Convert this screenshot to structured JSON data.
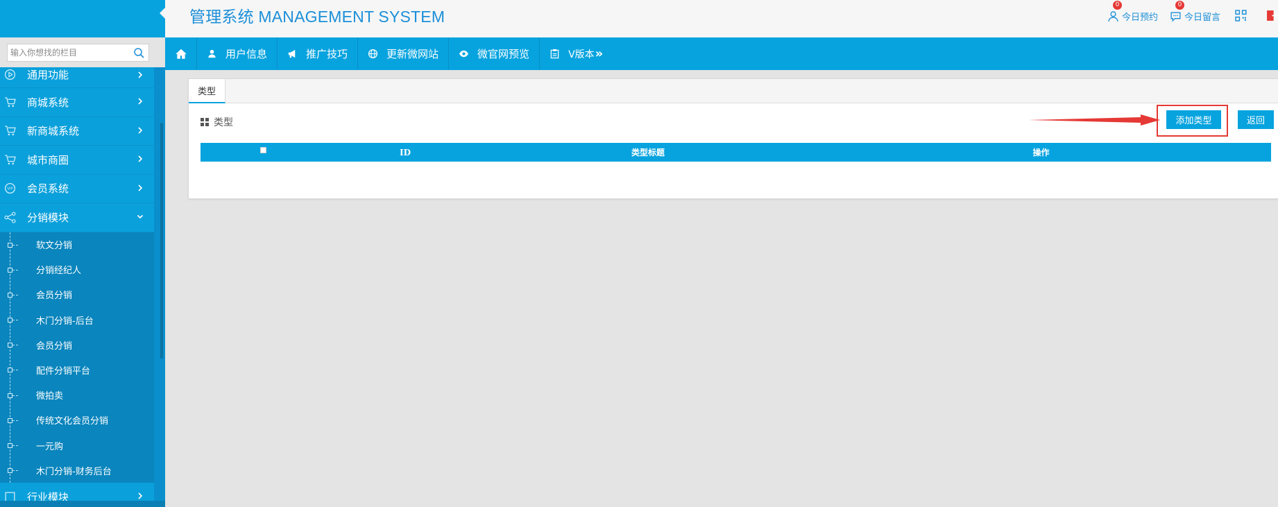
{
  "header": {
    "title": "管理系统 MANAGEMENT SYSTEM",
    "appointments": {
      "label": "今日预约",
      "count": "0"
    },
    "messages": {
      "label": "今日留言",
      "count": "0"
    }
  },
  "search": {
    "placeholder": "输入你想找的栏目"
  },
  "navbar": {
    "items": [
      {
        "label": "用户信息",
        "icon": "user-icon"
      },
      {
        "label": "推广技巧",
        "icon": "megaphone-icon"
      },
      {
        "label": "更新微网站",
        "icon": "globe-icon"
      },
      {
        "label": "微官网预览",
        "icon": "eye-icon"
      },
      {
        "label": "V版本",
        "icon": "clipboard-icon"
      }
    ]
  },
  "sidebar": {
    "items": [
      {
        "label": "通用功能",
        "icon": "play-circle-icon"
      },
      {
        "label": "商城系统",
        "icon": "cart-icon"
      },
      {
        "label": "新商城系统",
        "icon": "cart-icon"
      },
      {
        "label": "城市商圈",
        "icon": "cart-icon"
      },
      {
        "label": "会员系统",
        "icon": "vip-icon"
      },
      {
        "label": "分销模块",
        "icon": "share-icon"
      }
    ],
    "sub_items": [
      "软文分销",
      "分销经纪人",
      "会员分销",
      "木门分销-后台",
      "会员分销",
      "配件分销平台",
      "微拍卖",
      "传统文化会员分销",
      "一元购",
      "木门分销-财务后台"
    ],
    "last_item": "行业模块"
  },
  "panel": {
    "tab": "类型",
    "section_title": "类型",
    "add_button": "添加类型",
    "back_button": "返回",
    "columns": [
      "ID",
      "类型标题",
      "操作"
    ]
  },
  "colors": {
    "primary": "#06a3df",
    "title": "#1c8fd8",
    "highlight": "#e53935"
  }
}
